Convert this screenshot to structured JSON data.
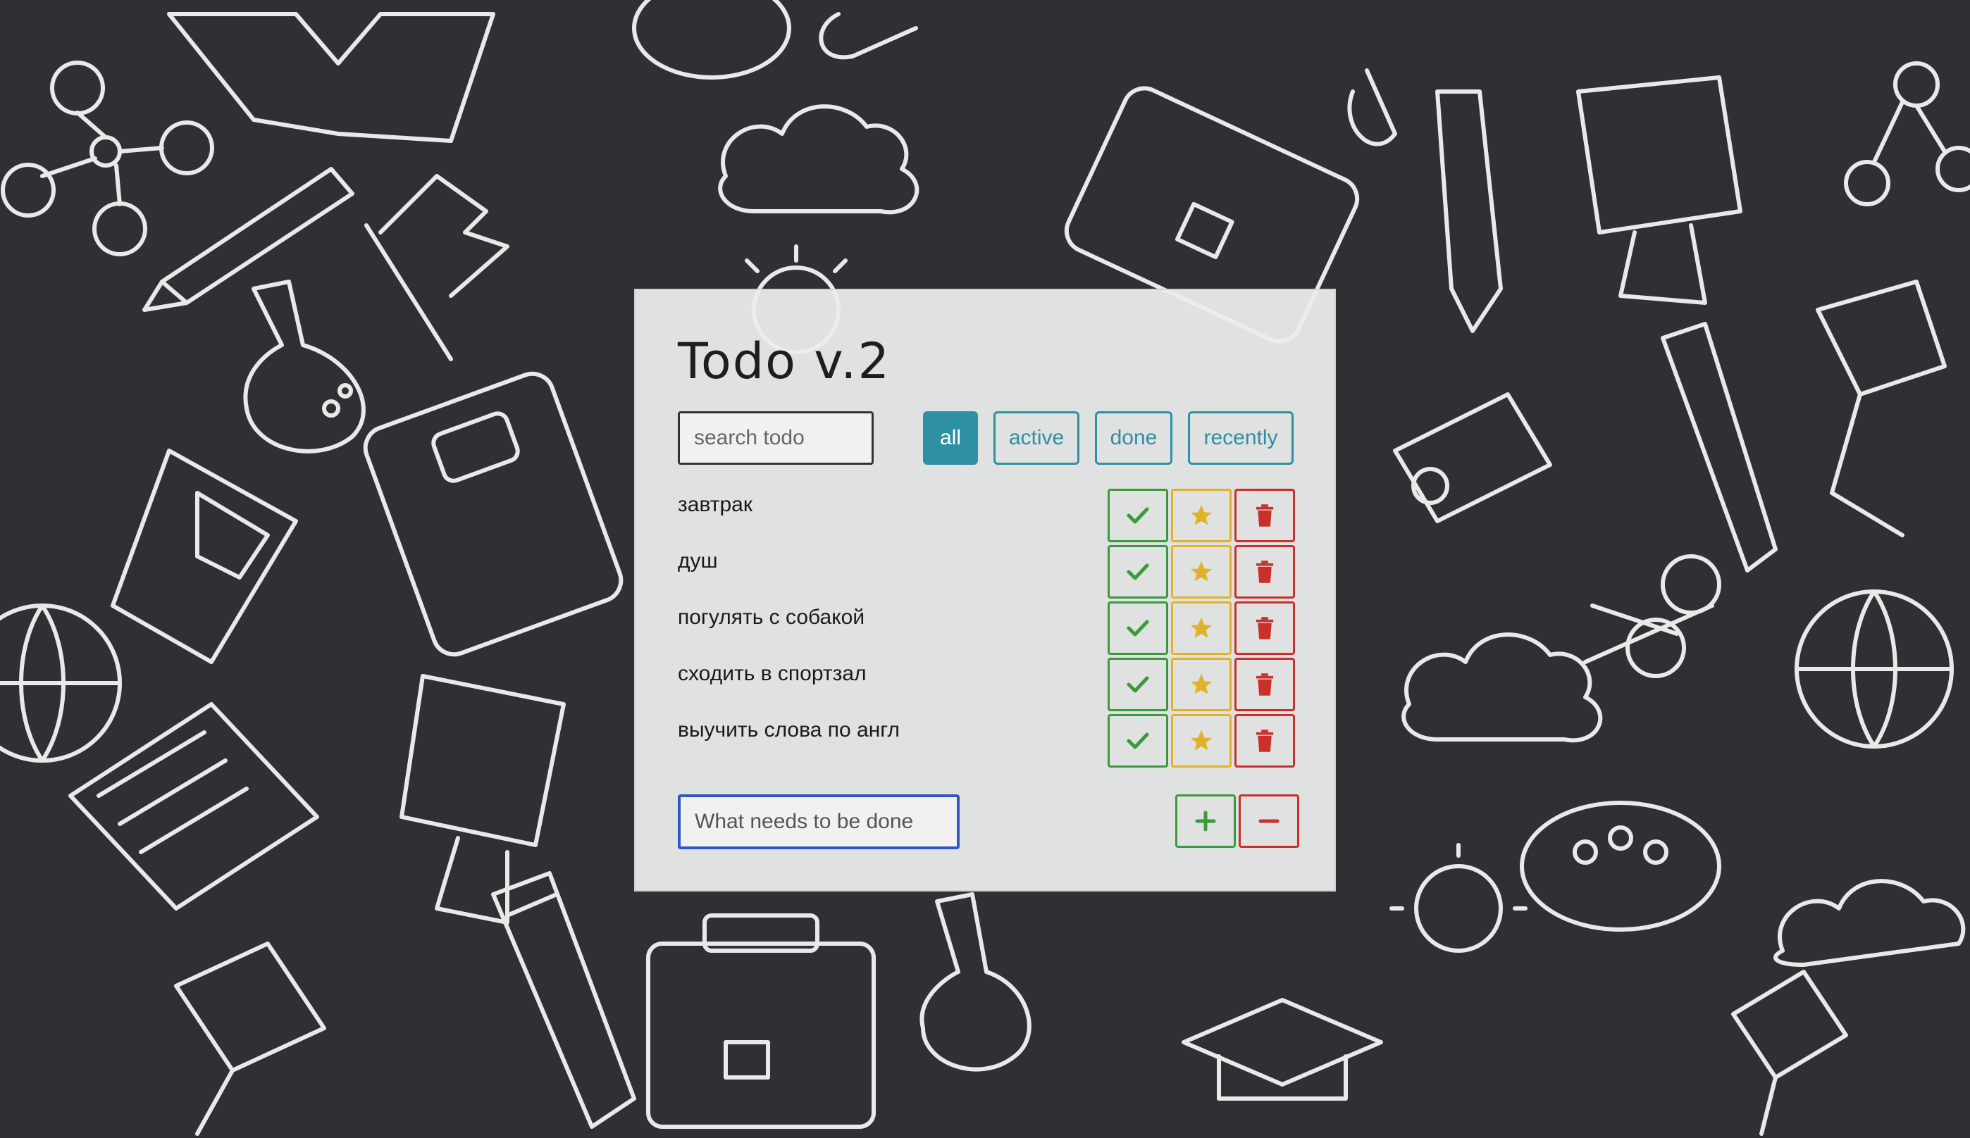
{
  "app": {
    "title": "Todo v.2"
  },
  "search": {
    "placeholder": "search todo"
  },
  "filters": [
    {
      "label": "all",
      "active": true
    },
    {
      "label": "active",
      "active": false
    },
    {
      "label": "done",
      "active": false
    },
    {
      "label": "recently",
      "active": false
    }
  ],
  "todos": [
    {
      "label": "завтрак"
    },
    {
      "label": "душ"
    },
    {
      "label": "погулять с собакой"
    },
    {
      "label": "сходить в спортзал"
    },
    {
      "label": "выучить слова по англ"
    }
  ],
  "new_todo": {
    "placeholder": "What needs to be done"
  },
  "icons": {
    "done": "check-icon",
    "important": "star-icon",
    "delete": "trash-icon",
    "add": "plus-icon",
    "remove": "minus-icon"
  },
  "colors": {
    "accent": "#2f8fa3",
    "green": "#3b9a3b",
    "yellow": "#e0b22a",
    "red": "#c9302c",
    "input_focus": "#2f57c4",
    "background": "#2f3033"
  }
}
